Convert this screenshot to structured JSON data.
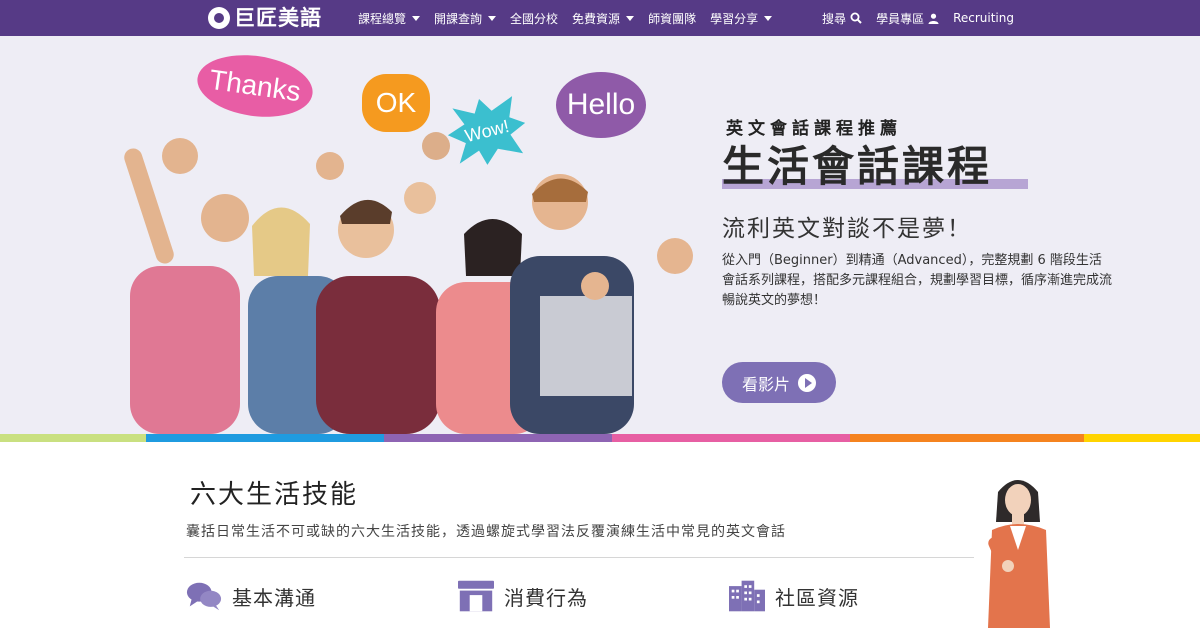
{
  "brand": {
    "name": "巨匠美語",
    "color": "#563a86"
  },
  "nav": {
    "items": [
      {
        "label": "課程總覽",
        "dropdown": true
      },
      {
        "label": "開課查詢",
        "dropdown": true
      },
      {
        "label": "全國分校",
        "dropdown": false
      },
      {
        "label": "免費資源",
        "dropdown": true
      },
      {
        "label": "師資團隊",
        "dropdown": false
      },
      {
        "label": "學習分享",
        "dropdown": true
      }
    ],
    "search_label": "搜尋",
    "member_label": "學員專區",
    "recruiting_label": "Recruiting"
  },
  "hero": {
    "bubbles": {
      "thanks": "Thanks",
      "ok": "OK",
      "wow": "Wow!",
      "hello": "Hello"
    },
    "subtitle": "英文會話課程推薦",
    "title": "生活會話課程",
    "tagline": "流利英文對談不是夢！",
    "description": "從入門（Beginner）到精通（Advanced），完整規劃 6 階段生活會話系列課程，搭配多元課程組合，規劃學習目標，循序漸進完成流暢說英文的夢想！",
    "button_label": "看影片",
    "accent_color": "#7e70b5"
  },
  "color_strip": [
    "#c9e080",
    "#1f9be0",
    "#8e64b3",
    "#e75fa3",
    "#f5831f",
    "#ffd400"
  ],
  "skills": {
    "title": "六大生活技能",
    "description": "囊括日常生活不可或缺的六大生活技能，透過螺旋式學習法反覆演練生活中常見的英文會話",
    "items": [
      {
        "label": "基本溝通",
        "icon": "chat-bubbles-icon"
      },
      {
        "label": "消費行為",
        "icon": "storefront-icon"
      },
      {
        "label": "社區資源",
        "icon": "buildings-icon"
      }
    ],
    "icon_color": "#7e70b5"
  }
}
